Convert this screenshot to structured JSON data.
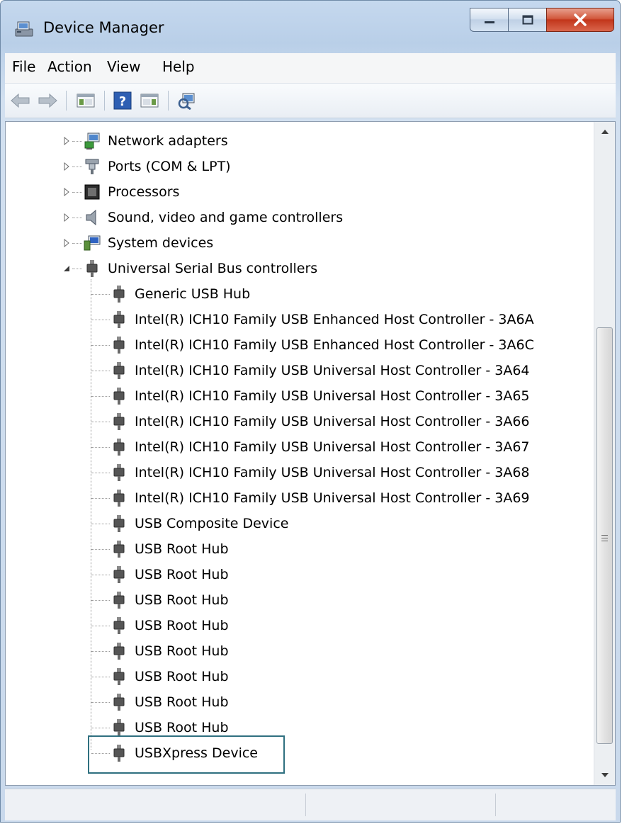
{
  "window": {
    "title": "Device Manager",
    "colors": {
      "title_bg": "#c5d8ee",
      "close_button": "#c2361b",
      "focus_box": "#2f7080"
    }
  },
  "menubar": {
    "file": "File",
    "action": "Action",
    "view": "View",
    "help": "Help"
  },
  "toolbar": {
    "icons": [
      "back-arrow-icon",
      "forward-arrow-icon",
      "show-hide-console-tree-icon",
      "help-icon",
      "properties-pane-icon",
      "scan-hardware-changes-icon"
    ]
  },
  "tree": {
    "categories": [
      {
        "label": "Network adapters",
        "icon": "network-adapter-icon",
        "expanded": false
      },
      {
        "label": "Ports (COM & LPT)",
        "icon": "port-icon",
        "expanded": false
      },
      {
        "label": "Processors",
        "icon": "processor-icon",
        "expanded": false
      },
      {
        "label": "Sound, video and game controllers",
        "icon": "speaker-icon",
        "expanded": false
      },
      {
        "label": "System devices",
        "icon": "system-devices-icon",
        "expanded": false
      },
      {
        "label": "Universal Serial Bus controllers",
        "icon": "usb-plug-icon",
        "expanded": true
      }
    ],
    "usb_devices": [
      "Generic USB Hub",
      "Intel(R) ICH10 Family USB Enhanced Host Controller - 3A6A",
      "Intel(R) ICH10 Family USB Enhanced Host Controller - 3A6C",
      "Intel(R) ICH10 Family USB Universal Host Controller - 3A64",
      "Intel(R) ICH10 Family USB Universal Host Controller - 3A65",
      "Intel(R) ICH10 Family USB Universal Host Controller - 3A66",
      "Intel(R) ICH10 Family USB Universal Host Controller - 3A67",
      "Intel(R) ICH10 Family USB Universal Host Controller - 3A68",
      "Intel(R) ICH10 Family USB Universal Host Controller - 3A69",
      "USB Composite Device",
      "USB Root Hub",
      "USB Root Hub",
      "USB Root Hub",
      "USB Root Hub",
      "USB Root Hub",
      "USB Root Hub",
      "USB Root Hub",
      "USB Root Hub",
      "USBXpress Device"
    ],
    "focused_item": "USBXpress Device"
  }
}
